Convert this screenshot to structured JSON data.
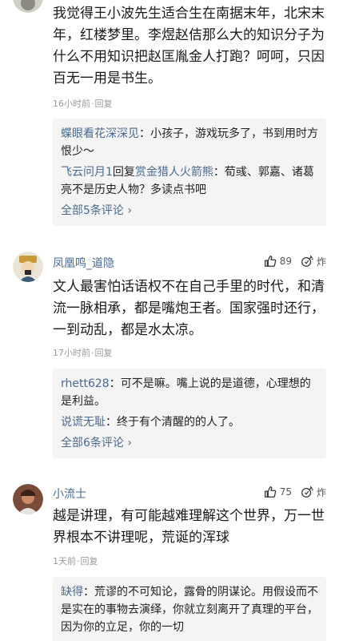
{
  "comments": [
    {
      "text": "我觉得王小波先生适合生在南据末年，北宋末年，红楼梦里。李煜赵佶那么大的知识分子为什么不用知识把赵匡胤金人打跑？呵呵，只因百无一用是书生。",
      "time": "16小时前",
      "reply_label": "回复",
      "replies": [
        {
          "author": "蝶眼看花深深见",
          "text": "：小孩子，游戏玩多了，书到用时方恨少～"
        },
        {
          "author": "飞云问月1",
          "verb": "回复",
          "target": "赏金猎人火箭熊",
          "text": "：荀彧、郭嘉、诸葛亮不是历史人物？多读点书吧"
        }
      ],
      "more_label": "全部5条评论 ›"
    },
    {
      "user": "凤凰鸣_道隐",
      "likes": "89",
      "burst_label": "炸",
      "text": "文人最害怕话语权不在自己手里的时代，和清流一脉相承，都是嘴炮王者。国家强时还行，一到动乱，都是水太凉。",
      "time": "17小时前",
      "reply_label": "回复",
      "replies": [
        {
          "author": "rhett628",
          "text": "：可不是嘛。嘴上说的是道德，心理想的是利益。"
        },
        {
          "author": "说谎无耻",
          "text": "：终于有个清醒的的人了。"
        }
      ],
      "more_label": "全部6条评论 ›"
    },
    {
      "user": "小流士",
      "likes": "75",
      "burst_label": "炸",
      "text": "越是讲理，有可能越难理解这个世界，万一世界根本不讲理呢，荒诞的浑球",
      "time": "1天前",
      "reply_label": "回复",
      "replies": [
        {
          "author": "缺得",
          "text": "：荒谬的不可知论，露骨的阴谋论。用假设而不是实在的事物去演绎，你就立刻离开了真理的平台，因为你的立足，你的一切"
        }
      ]
    }
  ],
  "colors": {
    "link": "#4a6a8c",
    "meta": "#9a9a9a",
    "reply_bg": "#f4f4f4"
  },
  "icons": {
    "like": "thumbs-up-icon",
    "burst": "burst-icon"
  }
}
